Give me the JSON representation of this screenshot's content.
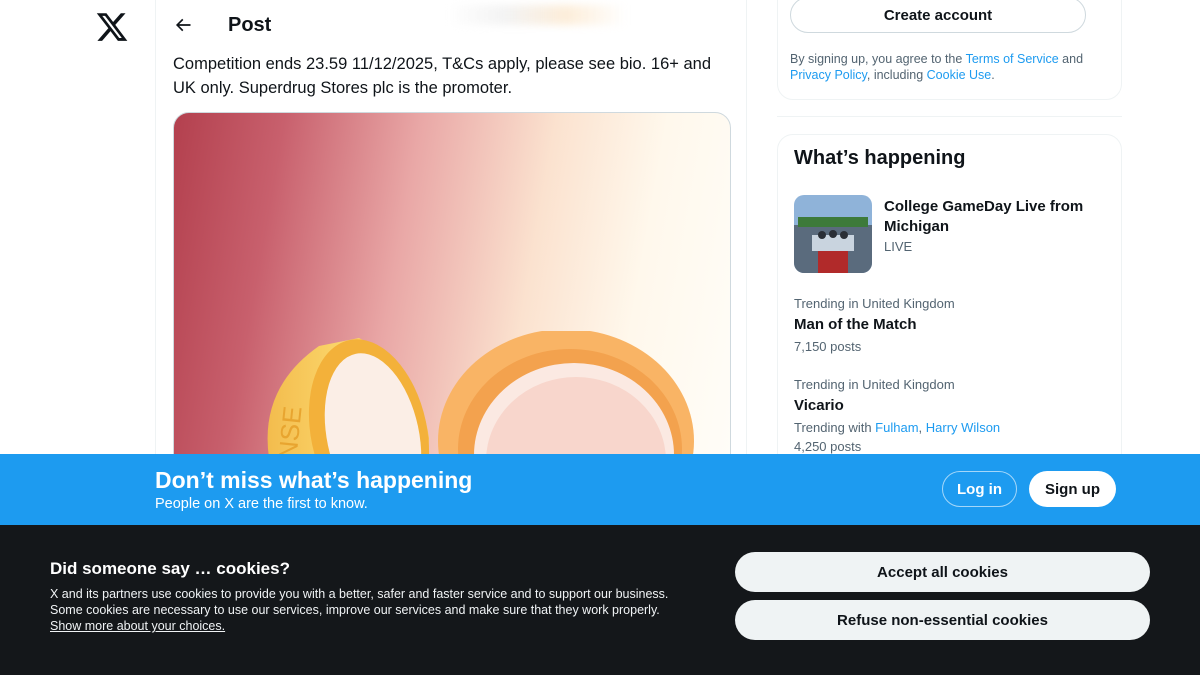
{
  "nav": {
    "logo_icon": "x-logo-icon"
  },
  "header": {
    "back_icon": "arrow-left-icon",
    "title": "Post"
  },
  "post": {
    "text": "Competition ends 23.59 11/12/2025, T&Cs apply, please see bio. 16+ and UK only. Superdrug Stores plc is the promoter.",
    "media_label": "CLEANSE"
  },
  "signup": {
    "create_label": "Create account",
    "note_prefix": "By signing up, you agree to the ",
    "terms": "Terms of Service",
    "and": " and ",
    "privacy": "Privacy Policy",
    "including": ", including ",
    "cookie_use": "Cookie Use",
    "period": "."
  },
  "happening": {
    "title": "What’s happening",
    "event": {
      "title": "College GameDay Live from Michigan",
      "status": "LIVE"
    },
    "trends": [
      {
        "meta": "Trending in United Kingdom",
        "name": "Man of the Match",
        "count": "7,150 posts"
      },
      {
        "meta": "Trending in United Kingdom",
        "name": "Vicario",
        "with_prefix": "Trending with ",
        "with_1": "Fulham",
        "with_sep": ", ",
        "with_2": "Harry Wilson",
        "count": "4,250 posts"
      }
    ]
  },
  "banner": {
    "title": "Don’t miss what’s happening",
    "subtitle": "People on X are the first to know.",
    "login_label": "Log in",
    "signup_label": "Sign up"
  },
  "cookies": {
    "title": "Did someone say … cookies?",
    "text": "X and its partners use cookies to provide you with a better, safer and faster service and to support our business. Some cookies are necessary to use our services, improve our services and make sure that they work properly. ",
    "link": "Show more about your choices.",
    "accept_label": "Accept all cookies",
    "refuse_label": "Refuse non-essential cookies"
  },
  "colors": {
    "accent": "#1d9bf0",
    "text": "#0f1419",
    "muted": "#536471",
    "cookie_bg": "#14171a"
  }
}
